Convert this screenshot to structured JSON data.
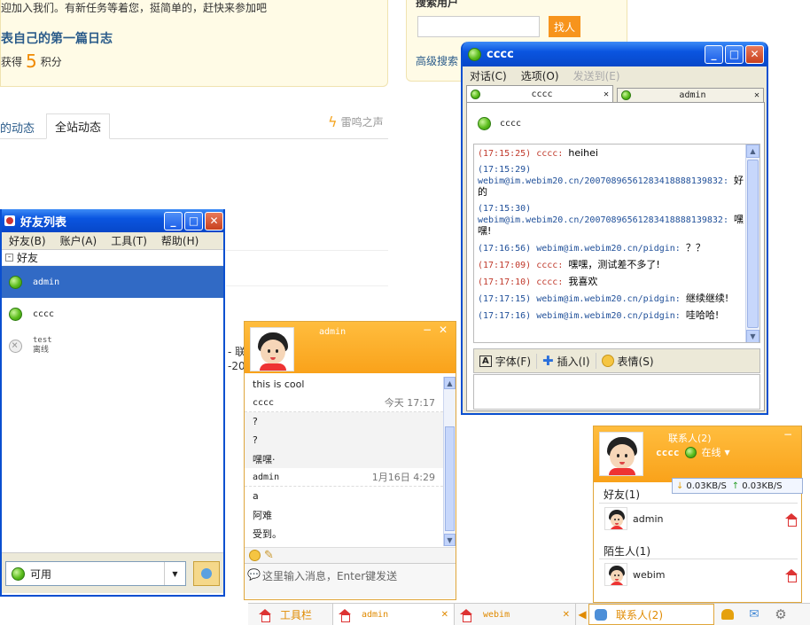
{
  "bg": {
    "welcome": "迎加入我们。有新任务等着您，挺简单的，赶快来参加吧",
    "task_title": "表自己的第一篇日志",
    "reward_prefix": "获得",
    "reward_num": "5",
    "reward_suffix": "积分",
    "search_title": "搜索用户",
    "find_btn": "找人",
    "adv_search": "高级搜索",
    "tab_my": "的动态",
    "tab_all": "全站动态",
    "thunder": "雷鸣之声",
    "frag1": "- 联",
    "frag2": "-20"
  },
  "buddy": {
    "title": "好友列表",
    "menu": [
      "好友(B)",
      "账户(A)",
      "工具(T)",
      "帮助(H)"
    ],
    "group": "好友",
    "items": [
      {
        "name": "admin",
        "status": "online"
      },
      {
        "name": "cccc",
        "status": "online"
      },
      {
        "name": "test",
        "sub": "离线",
        "status": "offline"
      }
    ],
    "status_value": "可用"
  },
  "im": {
    "title": "cccc",
    "menu": [
      "对话(C)",
      "选项(O)",
      "发送到(E)"
    ],
    "tabs": [
      "cccc",
      "admin"
    ],
    "contact": "cccc",
    "messages": [
      {
        "time": "(17:15:25)",
        "who": "cccc:",
        "text": "heihei",
        "mine": true
      },
      {
        "time": "(17:15:29)",
        "who": "webim@im.webim20.cn/2007089656128341888813983​2:",
        "text": "好的",
        "mine": false
      },
      {
        "time": "(17:15:30)",
        "who": "webim@im.webim20.cn/2007089656128341888813983​2:",
        "text": "嘿嘿!",
        "mine": false
      },
      {
        "time": "(17:16:56)",
        "who": "webim@im.webim20.cn/pidgin:",
        "text": "？？",
        "mine": false
      },
      {
        "time": "(17:17:09)",
        "who": "cccc:",
        "text": "嘿嘿，测试差不多了!",
        "mine": true
      },
      {
        "time": "(17:17:10)",
        "who": "cccc:",
        "text": "我喜欢",
        "mine": true
      },
      {
        "time": "(17:17:15)",
        "who": "webim@im.webim20.cn/pidgin:",
        "text": "继续继续!",
        "mine": false
      },
      {
        "time": "(17:17:16)",
        "who": "webim@im.webim20.cn/pidgin:",
        "text": "哇哈哈!",
        "mine": false
      }
    ],
    "toolbar": [
      "字体(F)",
      "插入(I)",
      "表情(S)"
    ]
  },
  "chat": {
    "title": "admin",
    "rows": [
      {
        "kind": "msg",
        "text": "this is cool"
      },
      {
        "kind": "head",
        "name": "cccc",
        "time": "今天 17:17"
      },
      {
        "kind": "msg",
        "text": "?"
      },
      {
        "kind": "msg",
        "text": "?"
      },
      {
        "kind": "msg",
        "text": "嘿嘿·"
      },
      {
        "kind": "head",
        "name": "admin",
        "time": "1月16日 4:29"
      },
      {
        "kind": "msg",
        "text": "a"
      },
      {
        "kind": "msg",
        "text": "阿难"
      },
      {
        "kind": "msg",
        "text": "受到。"
      }
    ],
    "input_placeholder": "这里输入消息，Enter键发送"
  },
  "contacts": {
    "title": "联系人(2)",
    "user": "cccc",
    "status": "在线",
    "down_speed": "0.03KB/S",
    "up_speed": "0.03KB/S",
    "group1": "好友(1)",
    "friend": "admin",
    "group2": "陌生人(1)",
    "stranger": "webim"
  },
  "taskbar": {
    "toolbar": "工具栏",
    "tab1": "admin",
    "tab2": "webim",
    "contacts": "联系人(2)"
  }
}
